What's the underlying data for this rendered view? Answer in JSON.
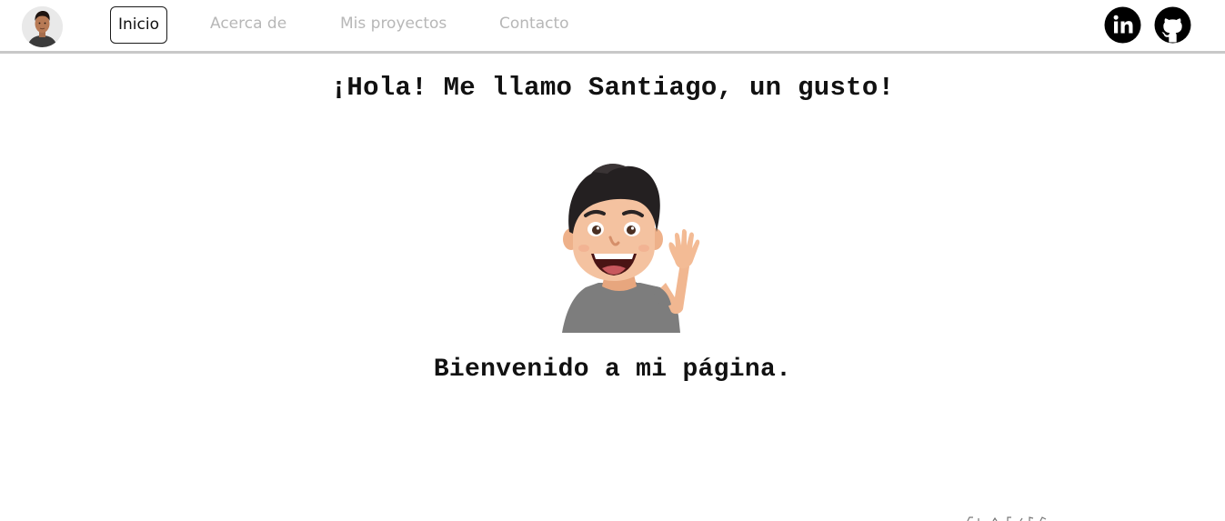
{
  "nav": {
    "links": [
      {
        "label": "Inicio",
        "active": true
      },
      {
        "label": "Acerca de",
        "active": false
      },
      {
        "label": "Mis proyectos",
        "active": false
      },
      {
        "label": "Contacto",
        "active": false
      }
    ],
    "social": [
      {
        "icon": "linkedin-icon",
        "label": "in"
      },
      {
        "icon": "github-icon"
      }
    ]
  },
  "main": {
    "title": "¡Hola! Me llamo Santiago, un gusto!",
    "welcome": "Bienvenido a mi página."
  },
  "colors": {
    "nav_inactive": "#b7b7b7",
    "nav_active": "#111111",
    "divider": "#c8c8c8",
    "text": "#111111",
    "icon": "#000000"
  }
}
